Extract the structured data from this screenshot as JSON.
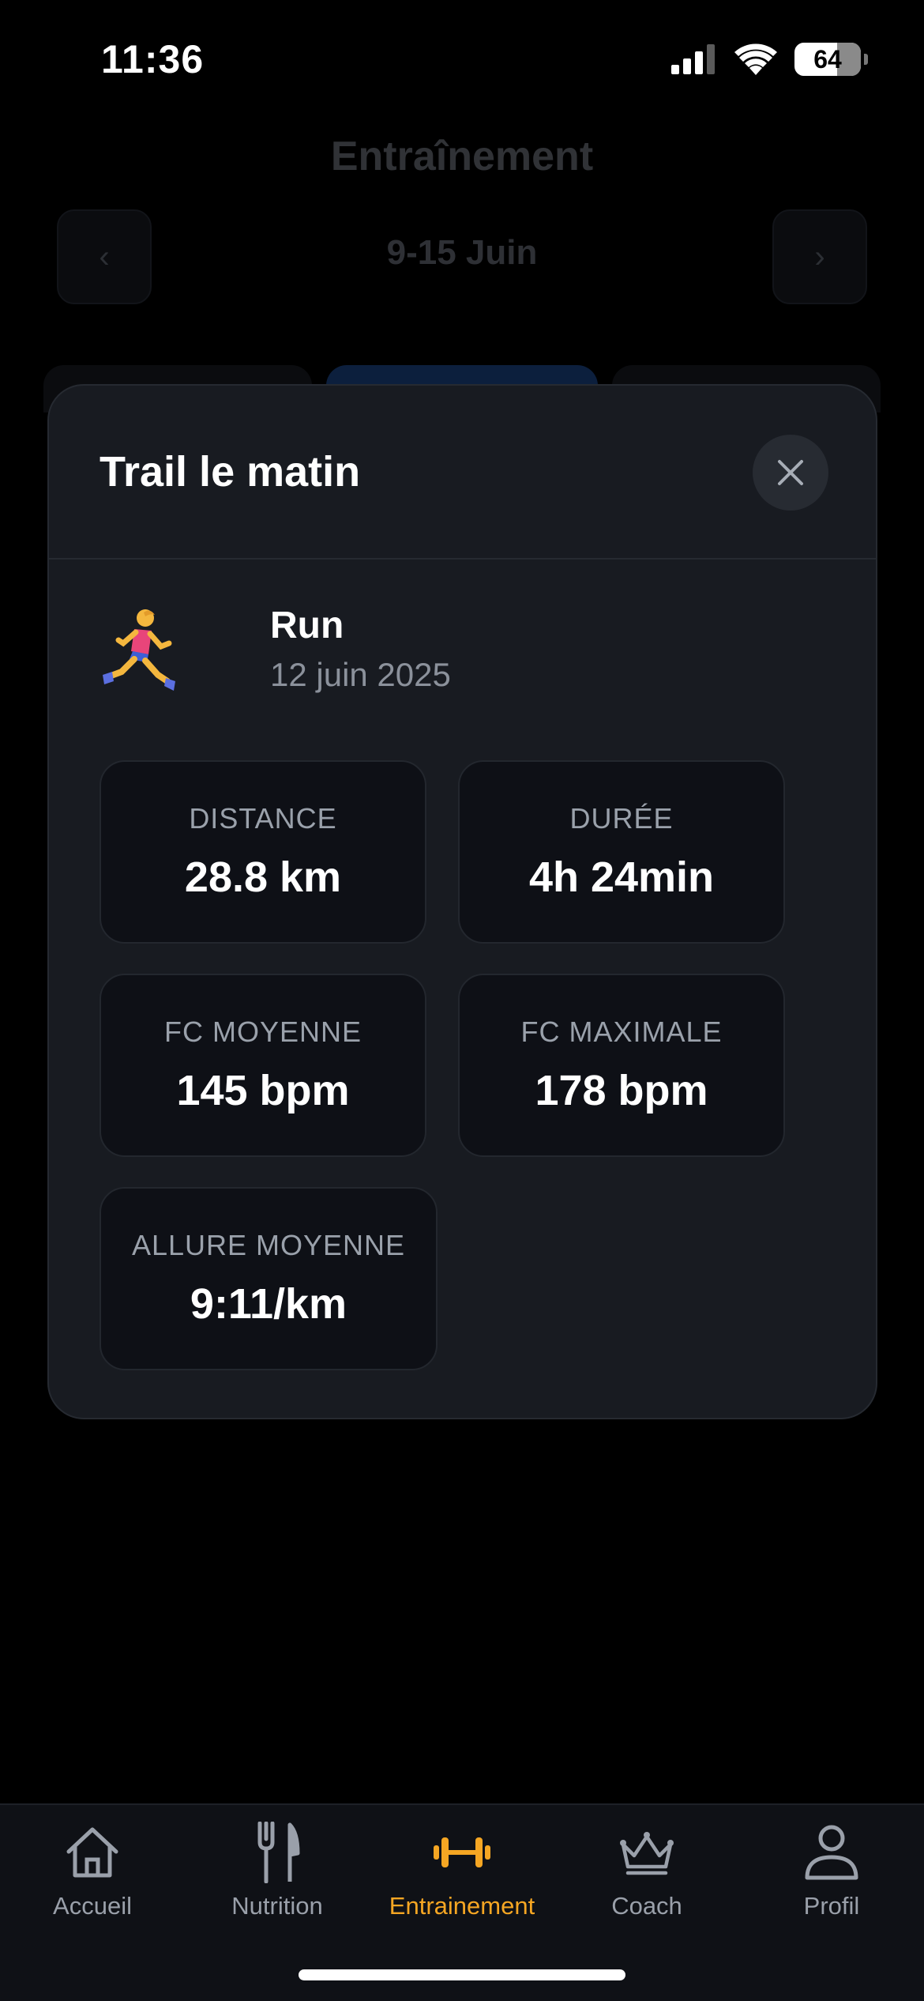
{
  "status_bar": {
    "time": "11:36",
    "battery": "64"
  },
  "background": {
    "title": "Entraînement",
    "week_label": "9-15 Juin",
    "prev_symbol": "‹",
    "next_symbol": "›"
  },
  "modal": {
    "title": "Trail le matin",
    "activity": {
      "type": "Run",
      "date": "12 juin 2025",
      "icon": "runner-icon"
    },
    "stats": [
      {
        "label": "DISTANCE",
        "value": "28.8 km"
      },
      {
        "label": "DURÉE",
        "value": "4h 24min"
      },
      {
        "label": "FC MOYENNE",
        "value": "145 bpm"
      },
      {
        "label": "FC MAXIMALE",
        "value": "178 bpm"
      },
      {
        "label": "ALLURE MOYENNE",
        "value": "9:11/km"
      }
    ]
  },
  "tab_bar": {
    "active_color": "#f5a623",
    "items": [
      {
        "label": "Accueil",
        "icon": "home-icon"
      },
      {
        "label": "Nutrition",
        "icon": "fork-knife-icon"
      },
      {
        "label": "Entrainement",
        "icon": "dumbbell-icon",
        "active": true
      },
      {
        "label": "Coach",
        "icon": "crown-icon"
      },
      {
        "label": "Profil",
        "icon": "person-icon"
      }
    ]
  }
}
